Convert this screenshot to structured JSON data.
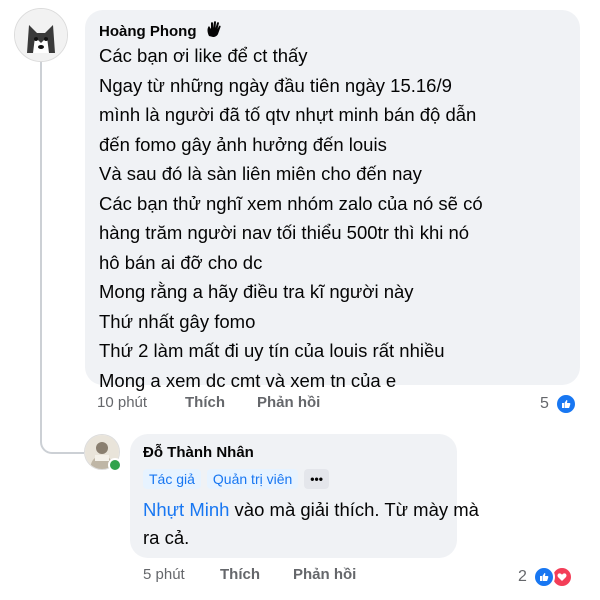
{
  "comment1": {
    "author": "Hoàng Phong",
    "author_badge_icon": "wave-hand-icon",
    "lines": [
      "Các bạn ơi like để ct thấy",
      "Ngay từ những ngày đầu tiên ngày 15.16/9",
      "mình là người đã tố qtv nhựt minh bán độ dẫn",
      "đến fomo gây ảnh hưởng đến louis",
      "Và sau đó là sàn liên miên cho đến nay",
      "Các bạn thử nghĩ xem nhóm zalo của nó sẽ có",
      "hàng trăm người nav tối thiểu 500tr thì khi nó",
      "hô bán ai đỡ cho dc",
      "Mong rằng a hãy điều tra kĩ người này",
      "Thứ nhất gây fomo",
      "Thứ 2 làm mất đi uy tín của louis rất nhiều",
      "Mong a xem dc cmt và xem tn của e"
    ],
    "time": "10 phút",
    "like_label": "Thích",
    "reply_label": "Phản hồi",
    "reaction_count": "5"
  },
  "comment2": {
    "author": "Đỗ Thành Nhân",
    "badge_author": "Tác giả",
    "badge_admin": "Quản trị viên",
    "more_label": "•••",
    "mention": "Nhựt Minh",
    "text_after_mention": " vào mà giải thích. Từ mày mà",
    "line2": "ra cả.",
    "time": "5 phút",
    "like_label": "Thích",
    "reply_label": "Phản hồi",
    "reaction_count": "2"
  },
  "colors": {
    "bubble": "#f0f2f5",
    "link": "#1877f2",
    "meta": "#65676b",
    "like": "#1877f2",
    "love": "#f33e58",
    "online": "#31a24c"
  }
}
